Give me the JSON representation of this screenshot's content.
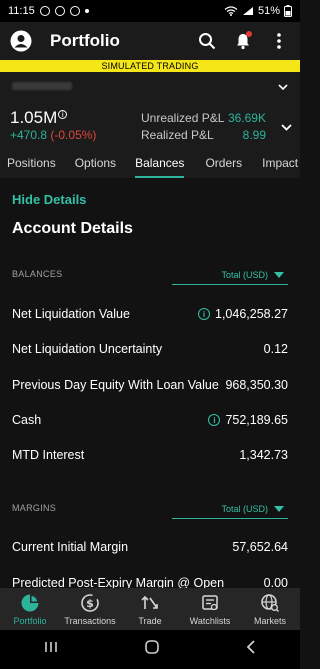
{
  "status_bar": {
    "time": "11:15",
    "battery": "51%"
  },
  "header": {
    "title": "Portfolio"
  },
  "banner": {
    "text": "SIMULATED TRADING"
  },
  "summary": {
    "net_liq": "1.05M",
    "change_abs": "+470.8",
    "change_pct": "(-0.05%)",
    "unrealized_label": "Unrealized P&L",
    "unrealized_value": "36.69K",
    "realized_label": "Realized P&L",
    "realized_value": "8.99"
  },
  "tabs": [
    {
      "label": "Positions"
    },
    {
      "label": "Options"
    },
    {
      "label": "Balances"
    },
    {
      "label": "Orders"
    },
    {
      "label": "Impact Len"
    }
  ],
  "content": {
    "hide_details": "Hide Details",
    "section_title": "Account Details",
    "balances": {
      "label": "BALANCES",
      "select": "Total (USD)",
      "rows": [
        {
          "label": "Net Liquidation Value",
          "value": "1,046,258.27"
        },
        {
          "label": "Net Liquidation Uncertainty",
          "value": "0.12"
        },
        {
          "label": "Previous Day Equity With Loan Value",
          "value": "968,350.30"
        },
        {
          "label": "Cash",
          "value": "752,189.65"
        },
        {
          "label": "MTD Interest",
          "value": "1,342.73"
        }
      ]
    },
    "margins": {
      "label": "MARGINS",
      "select": "Total (USD)",
      "rows": [
        {
          "label": "Current Initial Margin",
          "value": "57,652.64"
        },
        {
          "label": "Predicted Post-Expiry Margin @ Open",
          "value": "0.00"
        }
      ]
    }
  },
  "bottom_nav": [
    {
      "label": "Portfolio",
      "icon": "pie-chart-icon"
    },
    {
      "label": "Transactions",
      "icon": "dollar-circle-icon"
    },
    {
      "label": "Trade",
      "icon": "arrows-icon"
    },
    {
      "label": "Watchlists",
      "icon": "watchlist-icon"
    },
    {
      "label": "Markets",
      "icon": "globe-search-icon"
    }
  ],
  "colors": {
    "accent": "#2db39c",
    "negative": "#e0473d",
    "banner": "#f5e617",
    "background": "#121212"
  }
}
